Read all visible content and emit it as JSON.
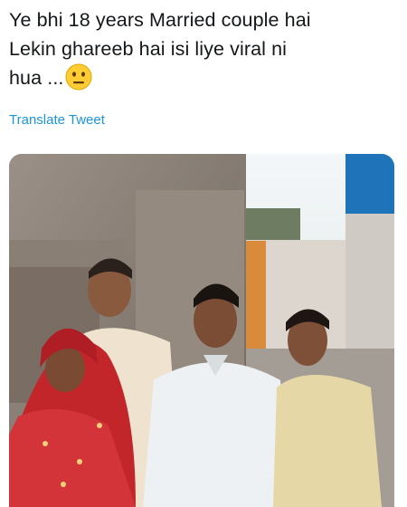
{
  "tweet": {
    "lines": [
      "Ye bhi 18 years Married couple hai",
      "Lekin ghareeb hai isi liye viral ni",
      "hua ..."
    ],
    "emoji": "neutral-face-emoji"
  },
  "translate_link": "Translate Tweet",
  "photo": {
    "subject": "group-photo",
    "icon": "photo-image"
  },
  "colors": {
    "text": "#14171a",
    "link": "#1b95e0"
  }
}
